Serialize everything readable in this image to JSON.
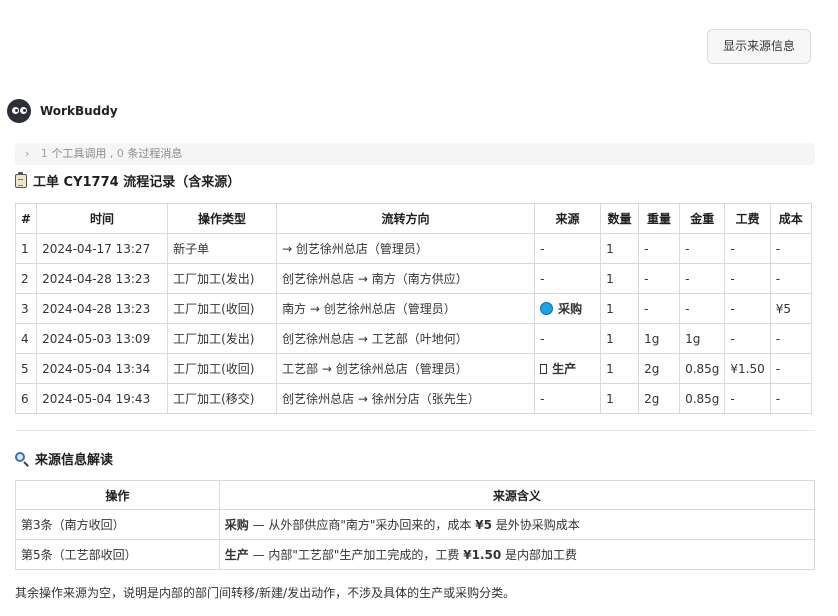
{
  "top_button": "显示来源信息",
  "agent": {
    "name": "WorkBuddy"
  },
  "tool_summary": {
    "count1": "1",
    "text1": "个工具调用",
    "sep": ",",
    "count2": "0",
    "text2": "条过程消息"
  },
  "section1": {
    "title": "工单 CY1774 流程记录（含来源）",
    "headers": [
      "#",
      "时间",
      "操作类型",
      "流转方向",
      "来源",
      "数量",
      "重量",
      "金重",
      "工费",
      "成本"
    ],
    "rows": [
      [
        "1",
        "2024-04-17 13:27",
        "新子单",
        "→ 创艺徐州总店（管理员）",
        "-",
        "1",
        "-",
        "-",
        "-",
        "-"
      ],
      [
        "2",
        "2024-04-28 13:23",
        "工厂加工(发出)",
        "创艺徐州总店 → 南方（南方供应）",
        "-",
        "1",
        "-",
        "-",
        "-",
        "-"
      ],
      [
        "3",
        "2024-04-28 13:23",
        "工厂加工(收回)",
        "南方 → 创艺徐州总店（管理员）",
        "采购",
        "1",
        "-",
        "-",
        "-",
        "¥5"
      ],
      [
        "4",
        "2024-05-03 13:09",
        "工厂加工(发出)",
        "创艺徐州总店 → 工艺部（叶地何）",
        "-",
        "1",
        "1g",
        "1g",
        "-",
        "-"
      ],
      [
        "5",
        "2024-05-04 13:34",
        "工厂加工(收回)",
        "工艺部 → 创艺徐州总店（管理员）",
        "生产",
        "1",
        "2g",
        "0.85g",
        "¥1.50",
        "-"
      ],
      [
        "6",
        "2024-05-04 19:43",
        "工厂加工(移交)",
        "创艺徐州总店 → 徐州分店（张先生）",
        "-",
        "1",
        "2g",
        "0.85g",
        "-",
        "-"
      ]
    ]
  },
  "section2": {
    "title": "来源信息解读",
    "headers": [
      "操作",
      "来源含义"
    ],
    "rows": [
      {
        "op": "第3条（南方收回）",
        "term": "采购",
        "rest1": " — 从外部供应商\"南方\"采办回来的，成本 ",
        "amount": "¥5",
        "rest2": " 是外协采购成本"
      },
      {
        "op": "第5条（工艺部收回）",
        "term": "生产",
        "rest1": " — 内部\"工艺部\"生产加工完成的，工费 ",
        "amount": "¥1.50",
        "rest2": " 是内部加工费"
      }
    ]
  },
  "footer": "其余操作来源为空，说明是内部的部门间转移/新建/发出动作，不涉及具体的生产或采购分类。",
  "colors": {
    "source_dot": "#1aa3e8",
    "border": "#d9d9d9"
  },
  "icons": {
    "title1": "clipboard-icon",
    "title2": "magnifier-icon",
    "source_purchase": "blue-circle-icon",
    "source_production": "box-icon"
  }
}
